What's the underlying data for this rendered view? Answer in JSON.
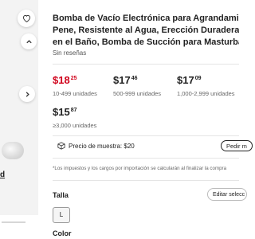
{
  "gallery": {
    "variant_label": "d"
  },
  "product": {
    "title_lines": [
      "Bomba de Vacío Electrónica para Agrandamiento de",
      "Pene, Resistente al Agua, Erección Duradera, Diver",
      "en el Baño, Bomba de Succión para Masturbación"
    ],
    "reviews": "Sin reseñas"
  },
  "price_tiers": [
    {
      "currency": "$",
      "int": "18",
      "dec": "25",
      "qty": "10-499 unidades"
    },
    {
      "currency": "$",
      "int": "17",
      "dec": "46",
      "qty": "500-999 unidades"
    },
    {
      "currency": "$",
      "int": "17",
      "dec": "09",
      "qty": "1,000-2,999 unidades"
    },
    {
      "currency": "$",
      "int": "15",
      "dec": "87",
      "qty": "≥3,000 unidades"
    }
  ],
  "sample": {
    "label": "Precio de muestra: $20",
    "button": "Pedir m"
  },
  "note": "*Los impuestos y los cargos por importación se calcularán al finalizar la compra",
  "variations": {
    "size_title": "Talla",
    "edit_button": "Editar selecc",
    "size_option": "L",
    "color_title": "Color"
  },
  "colors": {
    "price_accent": "#d0021b"
  }
}
